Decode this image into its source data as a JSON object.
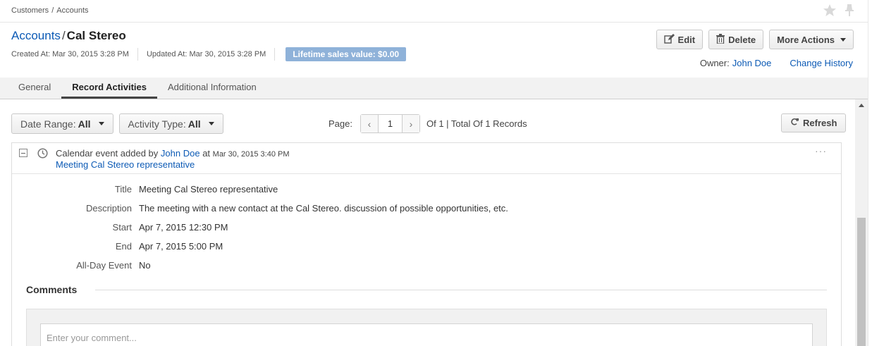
{
  "breadcrumb": [
    "Customers",
    "Accounts"
  ],
  "header": {
    "entity_link": "Accounts",
    "separator": "/",
    "record_name": "Cal Stereo",
    "created_at": "Created At: Mar 30, 2015 3:28 PM",
    "updated_at": "Updated At: Mar 30, 2015 3:28 PM",
    "lifetime_sales": "Lifetime sales value: $0.00"
  },
  "actions": {
    "edit": "Edit",
    "delete": "Delete",
    "more_actions": "More Actions"
  },
  "owner": {
    "label": "Owner:",
    "name": "John Doe",
    "change_history": "Change History"
  },
  "tabs": [
    {
      "label": "General",
      "active": false
    },
    {
      "label": "Record Activities",
      "active": true
    },
    {
      "label": "Additional Information",
      "active": false
    }
  ],
  "toolbar": {
    "date_range_label": "Date Range:",
    "date_range_value": "All",
    "activity_type_label": "Activity Type:",
    "activity_type_value": "All",
    "page_label": "Page:",
    "page_value": "1",
    "page_summary": "Of 1 | Total Of 1 Records",
    "refresh": "Refresh"
  },
  "activity": {
    "event_text": "Calendar event added by",
    "user": "John Doe",
    "at_text": "at",
    "when": "Mar 30, 2015 3:40 PM",
    "link": "Meeting Cal Stereo representative",
    "more": "···",
    "details": [
      {
        "label": "Title",
        "value": "Meeting Cal Stereo representative"
      },
      {
        "label": "Description",
        "value": "The meeting with a new contact at the Cal Stereo. discussion of possible opportunities, etc."
      },
      {
        "label": "Start",
        "value": "Apr 7, 2015 12:30 PM"
      },
      {
        "label": "End",
        "value": "Apr 7, 2015 5:00 PM"
      },
      {
        "label": "All-Day Event",
        "value": "No"
      }
    ]
  },
  "comments": {
    "title": "Comments",
    "placeholder": "Enter your comment..."
  },
  "colors": {
    "link": "#0c5ab5",
    "badge": "#8fb2d9"
  }
}
